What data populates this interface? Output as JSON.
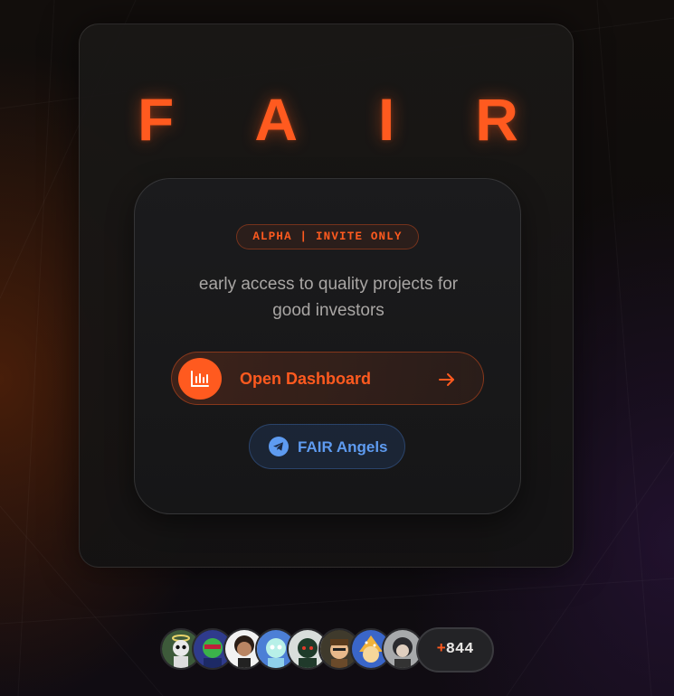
{
  "brand": {
    "letters": [
      "F",
      "A",
      "I",
      "R"
    ],
    "color": "#ff5a1f"
  },
  "badge": {
    "text": "ALPHA | INVITE ONLY"
  },
  "tagline": {
    "line1": "early access to quality projects for",
    "line2": "good investors"
  },
  "dashboard_button": {
    "label": "Open Dashboard",
    "icon": "bar-chart-icon",
    "trailing_icon": "arrow-right-icon"
  },
  "telegram_button": {
    "label": "FAIR Angels",
    "icon": "telegram-icon"
  },
  "community": {
    "avatar_count": 8,
    "extra_prefix": "+",
    "extra_count": "844"
  },
  "colors": {
    "accent": "#ff5a1f",
    "telegram": "#5e9bf0",
    "background": "#100d0d"
  }
}
